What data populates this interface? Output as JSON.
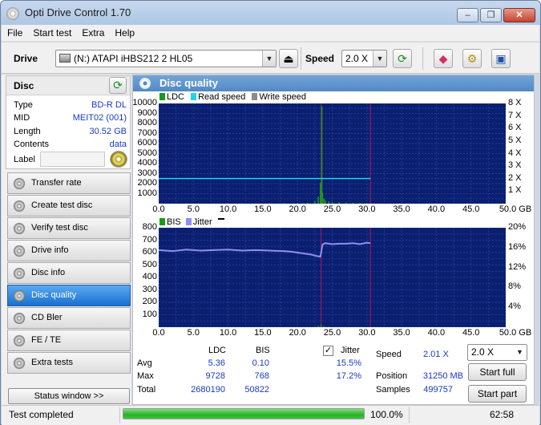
{
  "window": {
    "title": "Opti Drive Control 1.70",
    "minimize": "‒",
    "maximize": "❐",
    "close": "✕"
  },
  "menu": [
    "File",
    "Start test",
    "Extra",
    "Help"
  ],
  "toolbar": {
    "drive_label": "Drive",
    "drive_value": "(N:)   ATAPI iHBS212   2 HL05",
    "speed_label": "Speed",
    "speed_value": "2.0 X"
  },
  "disc": {
    "header": "Disc",
    "rows": [
      {
        "key": "Type",
        "value": "BD-R DL"
      },
      {
        "key": "MID",
        "value": "MEIT02 (001)"
      },
      {
        "key": "Length",
        "value": "30.52 GB"
      },
      {
        "key": "Contents",
        "value": "data"
      },
      {
        "key": "Label",
        "value": ""
      }
    ]
  },
  "nav": [
    {
      "label": "Transfer rate",
      "active": false
    },
    {
      "label": "Create test disc",
      "active": false
    },
    {
      "label": "Verify test disc",
      "active": false
    },
    {
      "label": "Drive info",
      "active": false
    },
    {
      "label": "Disc info",
      "active": false
    },
    {
      "label": "Disc quality",
      "active": true
    },
    {
      "label": "CD Bler",
      "active": false
    },
    {
      "label": "FE / TE",
      "active": false
    },
    {
      "label": "Extra tests",
      "active": false
    }
  ],
  "status_window_button": "Status window >>",
  "panel": {
    "title": "Disc quality"
  },
  "chart_data": [
    {
      "type": "line",
      "legend": [
        "LDC",
        "Read speed",
        "Write speed"
      ],
      "colors": {
        "LDC": "#1a9a1a",
        "Read speed": "#21d4ee",
        "Write speed": "#8c8c8c"
      },
      "x_ticks": [
        "0.0",
        "5.0",
        "10.0",
        "15.0",
        "20.0",
        "25.0",
        "30.0",
        "35.0",
        "40.0",
        "45.0",
        "50.0 GB"
      ],
      "y_ticks_left": [
        "10000",
        "9000",
        "8000",
        "7000",
        "6000",
        "5000",
        "4000",
        "3000",
        "2000",
        "1000"
      ],
      "y_ticks_right": [
        "8 X",
        "7 X",
        "6 X",
        "5 X",
        "4 X",
        "3 X",
        "2 X",
        "1 X"
      ],
      "xlim": [
        0,
        50
      ],
      "ylim": [
        0,
        10000
      ],
      "y2lim": [
        0,
        8
      ],
      "series": [
        {
          "name": "LDC",
          "x": [
            0.5,
            2,
            4,
            6,
            8,
            10,
            12,
            14,
            16,
            18,
            20,
            21.5,
            22.5,
            23,
            23.3,
            23.5,
            23.6,
            23.8,
            24,
            24.5,
            25,
            26,
            27,
            28,
            29,
            30,
            30.5
          ],
          "y": [
            40,
            30,
            35,
            25,
            30,
            40,
            30,
            35,
            30,
            40,
            60,
            90,
            250,
            700,
            2100,
            9728,
            1100,
            500,
            350,
            250,
            200,
            150,
            120,
            90,
            80,
            60,
            40
          ]
        },
        {
          "name": "Read speed",
          "x": [
            0,
            30.5
          ],
          "y": [
            2.01,
            2.01
          ]
        }
      ],
      "markers_x": [
        23.4,
        30.5
      ]
    },
    {
      "type": "line",
      "legend": [
        "BIS",
        "Jitter"
      ],
      "colors": {
        "BIS": "#1a9a1a",
        "Jitter": "#8f8ff2"
      },
      "x_ticks": [
        "0.0",
        "5.0",
        "10.0",
        "15.0",
        "20.0",
        "25.0",
        "30.0",
        "35.0",
        "40.0",
        "45.0",
        "50.0 GB"
      ],
      "y_ticks_left": [
        "800",
        "700",
        "600",
        "500",
        "400",
        "300",
        "200",
        "100"
      ],
      "y_ticks_right": [
        "20%",
        "16%",
        "12%",
        "8%",
        "4%"
      ],
      "xlim": [
        0,
        50
      ],
      "ylim": [
        0,
        800
      ],
      "y2lim": [
        0,
        20
      ],
      "series": [
        {
          "name": "BIS",
          "x": [
            0,
            10,
            20,
            22.5,
            23,
            23.4,
            23.8,
            24.5,
            30.5
          ],
          "y": [
            1,
            1,
            2,
            4,
            12,
            22,
            10,
            3,
            1
          ]
        },
        {
          "name": "Jitter",
          "x": [
            0,
            2,
            4,
            6,
            8,
            10,
            12,
            14,
            16,
            18,
            19,
            20,
            21,
            22,
            22.8,
            23.3,
            23.6,
            24,
            25,
            26,
            27,
            28,
            29,
            30,
            30.5
          ],
          "y": [
            15.5,
            15.3,
            15.6,
            15.4,
            15.5,
            15.6,
            15.4,
            15.5,
            15.4,
            15.3,
            15.2,
            15.0,
            14.8,
            14.6,
            14.3,
            14.2,
            16.6,
            16.9,
            16.7,
            16.8,
            16.8,
            16.9,
            16.7,
            17.0,
            16.9
          ]
        }
      ],
      "markers_x": [
        23.4,
        30.5
      ]
    }
  ],
  "stats": {
    "col_ldc": "LDC",
    "col_bis": "BIS",
    "col_jitter": "Jitter",
    "jitter_checked": true,
    "row_avg": "Avg",
    "row_max": "Max",
    "row_total": "Total",
    "avg_ldc": "5.36",
    "avg_bis": "0.10",
    "avg_jitter": "15.5%",
    "max_ldc": "9728",
    "max_bis": "768",
    "max_jitter": "17.2%",
    "total_ldc": "2680190",
    "total_bis": "50822",
    "speed_label": "Speed",
    "speed_value": "2.01 X",
    "speed_select": "2.0 X",
    "position_label": "Position",
    "position_value": "31250 MB",
    "samples_label": "Samples",
    "samples_value": "499757",
    "start_full": "Start full",
    "start_part": "Start part"
  },
  "status": {
    "text": "Test completed",
    "progress": 100,
    "progress_text": "100.0%",
    "time": "62:58"
  }
}
